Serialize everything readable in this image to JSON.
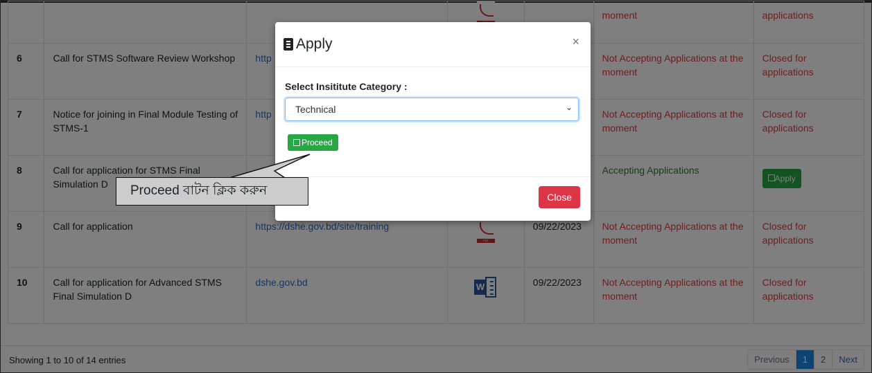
{
  "table": {
    "partial_row": {
      "file": "pdf",
      "status": "moment",
      "button": "applications"
    },
    "rows": [
      {
        "num": "6",
        "title": "Call for STMS Software Review Workshop",
        "link": "http",
        "file": "",
        "date": "",
        "status": "Not Accepting Applications at the moment",
        "action": "Closed for applications"
      },
      {
        "num": "7",
        "title": "Notice for joining in Final Module Testing of STMS-1",
        "link": "http",
        "file": "",
        "date": "",
        "status": "Not Accepting Applications at the moment",
        "action": "Closed for applications"
      },
      {
        "num": "8",
        "title": "Call for application for STMS Final Simulation D",
        "link": "",
        "file": "",
        "date": "",
        "status": "Accepting Applications",
        "action": "Apply"
      },
      {
        "num": "9",
        "title": "Call for application",
        "link": "https://dshe.gov.bd/site/training",
        "file": "pdf",
        "date": "09/22/2023",
        "status": "Not Accepting Applications at the moment",
        "action": "Closed for applications"
      },
      {
        "num": "10",
        "title": "Call for application for Advanced STMS Final Simulation D",
        "link": "dshe.gov.bd",
        "file": "word",
        "date": "09/22/2023",
        "status": "Not Accepting Applications at the moment",
        "action": "Closed for applications"
      }
    ]
  },
  "footer": {
    "info": "Showing 1 to 10 of 14 entries",
    "pager": [
      "Previous",
      "1",
      "2",
      "Next"
    ]
  },
  "modal": {
    "title": "Apply",
    "close_x": "×",
    "label": "Select Insititute Category :",
    "select_value": "Technical",
    "proceed_label": "Proceed",
    "close_label": "Close"
  },
  "callout": {
    "text": "Proceed বাটন ক্লিক করুন"
  },
  "icons": [
    "pdf-icon",
    "word-icon",
    "id-card-icon",
    "edit-icon",
    "chevron-down-icon"
  ],
  "colors": {
    "red": "#e03c3c",
    "green": "#28a745",
    "link": "#2b6cc4",
    "close": "#dc3545",
    "active_page": "#1e88e5"
  }
}
